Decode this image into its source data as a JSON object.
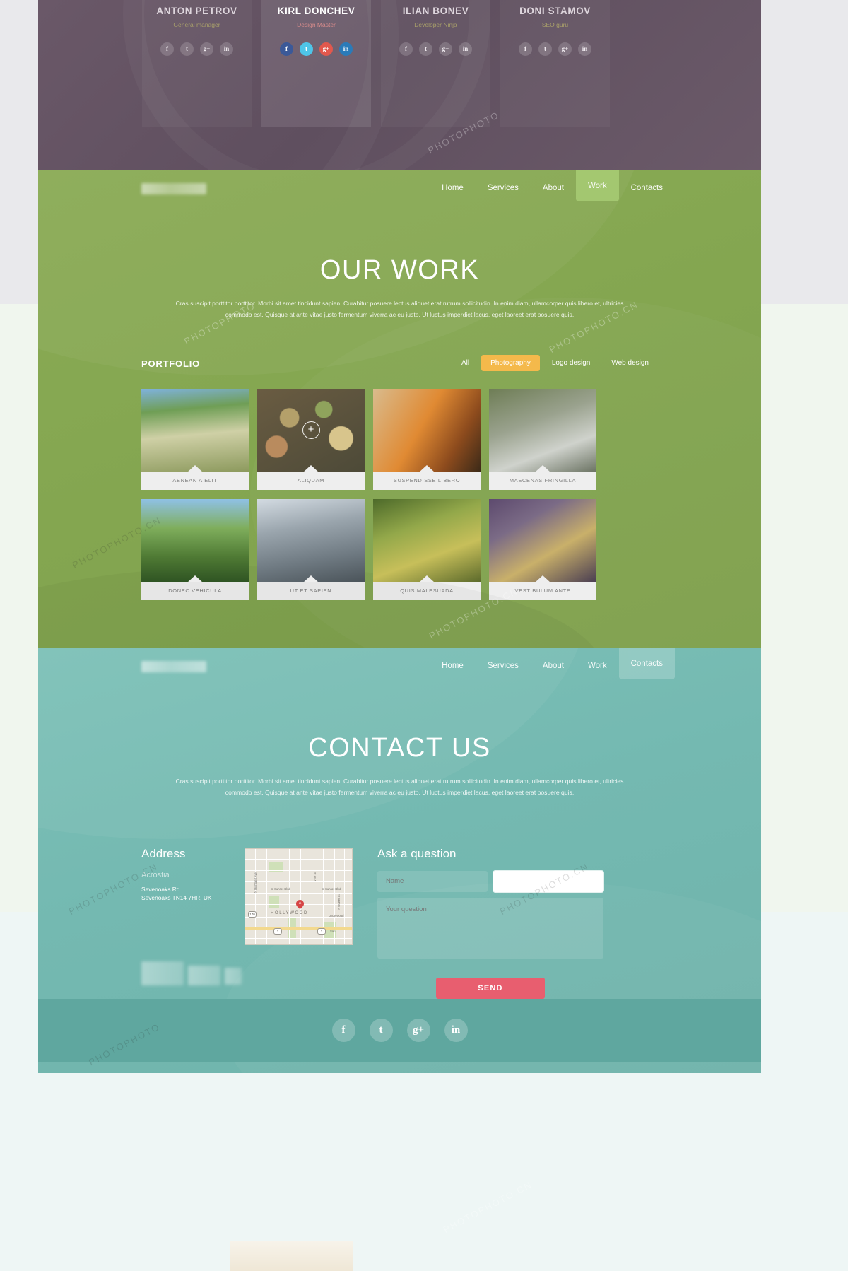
{
  "team": {
    "members": [
      {
        "name": "ANTON PETROV",
        "role": "General manager",
        "featured": false
      },
      {
        "name": "KIRL DONCHEV",
        "role": "Design Master",
        "featured": true
      },
      {
        "name": "ILIAN BONEV",
        "role": "Developer Ninja",
        "featured": false
      },
      {
        "name": "DONI STAMOV",
        "role": "SEO guru",
        "featured": false
      }
    ],
    "social_icons": [
      "f",
      "t",
      "g+",
      "in"
    ]
  },
  "work": {
    "nav": [
      {
        "label": "Home",
        "active": false
      },
      {
        "label": "Services",
        "active": false
      },
      {
        "label": "About",
        "active": false
      },
      {
        "label": "Work",
        "active": true
      },
      {
        "label": "Contacts",
        "active": false
      }
    ],
    "title": "OUR WORK",
    "subtitle": "Cras suscipit porttitor porttitor. Morbi sit amet tincidunt sapien. Curabitur posuere lectus aliquet erat rutrum sollicitudin. In enim diam, ullamcorper quis libero et, ultricies commodo est. Quisque at ante vitae justo fermentum viverra ac eu justo. Ut luctus imperdiet lacus, eget laoreet erat posuere quis.",
    "portfolio_label": "PORTFOLIO",
    "filters": [
      {
        "label": "All",
        "active": false
      },
      {
        "label": "Photography",
        "active": true
      },
      {
        "label": "Logo design",
        "active": false
      },
      {
        "label": "Web design",
        "active": false
      }
    ],
    "accent_active_filter": "#f4b94b",
    "items": [
      {
        "caption": "AENEAN A ELIT",
        "hover": false
      },
      {
        "caption": "ALIQUAM",
        "hover": true
      },
      {
        "caption": "SUSPENDISSE LIBERO",
        "hover": false
      },
      {
        "caption": "MAECENAS FRINGILLA",
        "hover": false
      },
      {
        "caption": "DONEC VEHICULA",
        "hover": false
      },
      {
        "caption": "UT ET SAPIEN",
        "hover": false
      },
      {
        "caption": "QUIS MALESUADA",
        "hover": false
      },
      {
        "caption": "VESTIBULUM ANTE",
        "hover": false
      }
    ],
    "hover_plus_icon": "+"
  },
  "contact": {
    "nav": [
      {
        "label": "Home",
        "active": false
      },
      {
        "label": "Services",
        "active": false
      },
      {
        "label": "About",
        "active": false
      },
      {
        "label": "Work",
        "active": false
      },
      {
        "label": "Contacts",
        "active": true
      }
    ],
    "title": "CONTACT US",
    "subtitle": "Cras suscipit porttitor porttitor. Morbi sit amet tincidunt sapien. Curabitur posuere lectus aliquet erat rutrum sollicitudin. In enim diam, ullamcorper quis libero et, ultricies commodo est. Quisque at ante vitae justo fermentum viverra ac eu justo. Ut luctus imperdiet lacus, eget laoreet erat posuere quis.",
    "address": {
      "heading": "Address",
      "company": "Acrostia",
      "line1": "Sevenoaks Rd",
      "line2": "Sevenoaks TN14 7HR, UK"
    },
    "map": {
      "city_label": "HOLLYWOOD",
      "marker_letter": "A",
      "streets": [
        "W Sunset Blvd",
        "W Sunset Blvd",
        "N Highland Ave",
        "Vine St",
        "N Gower St",
        "Underwood"
      ],
      "route_shields": [
        "170",
        "2",
        "2"
      ],
      "extra_label": "San"
    },
    "form": {
      "heading": "Ask a question",
      "name_placeholder": "Name",
      "email_placeholder": "",
      "email_value": "",
      "message_placeholder": "Your question",
      "send_label": "SEND",
      "send_color": "#e8596a"
    },
    "footer_social": [
      "f",
      "t",
      "g+",
      "in"
    ]
  },
  "watermark": {
    "cn": "PHOTOPHOTO.CN",
    "plain": "PHOTOPHOTO"
  }
}
